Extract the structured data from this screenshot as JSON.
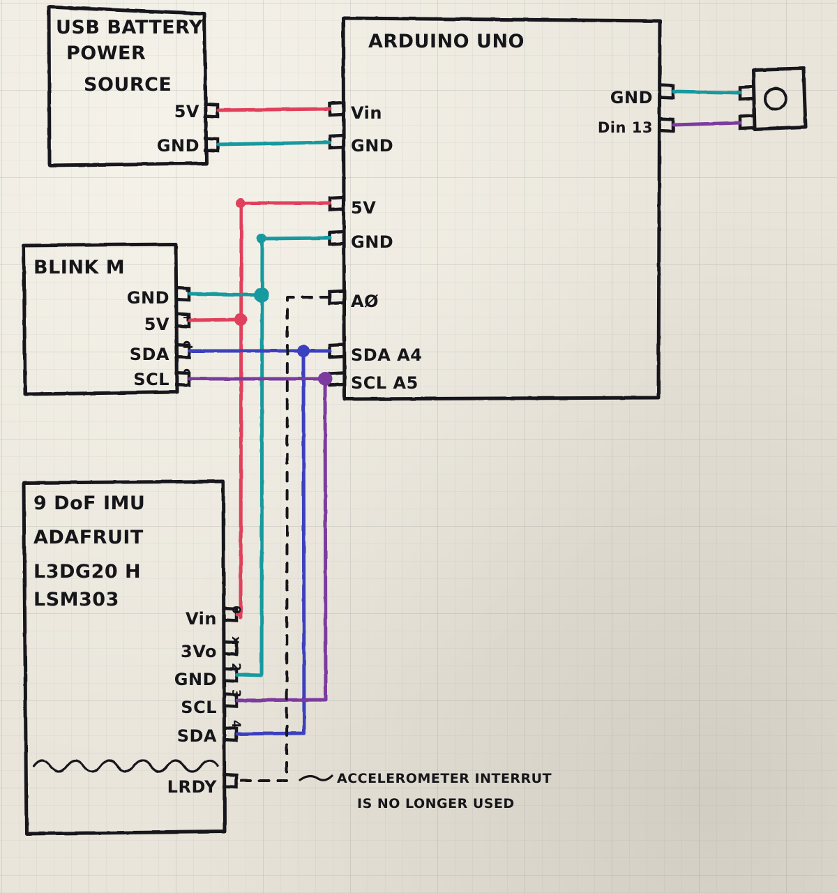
{
  "diagram": {
    "title": "Hand-drawn Arduino Uno wiring diagram on graph paper",
    "medium": "pen on graph paper"
  },
  "colors": {
    "ink": "#16161a",
    "paper": "#e9e5db",
    "wire_power_red": "#e0415c",
    "wire_ground_teal": "#17999f",
    "wire_sda_blue": "#3a3fbe",
    "wire_scl_purple": "#7b3b9e"
  },
  "blocks": {
    "usb_battery": {
      "title_lines": [
        "USB BATTERY",
        "POWER",
        "SOURCE"
      ],
      "pins": [
        {
          "label": "5V",
          "wire": "wire_power_red"
        },
        {
          "label": "GND",
          "wire": "wire_ground_teal"
        }
      ]
    },
    "arduino": {
      "title": "ARDUINO UNO",
      "left_pins": [
        {
          "label": "Vin",
          "wire": "wire_power_red"
        },
        {
          "label": "GND",
          "wire": "wire_ground_teal"
        },
        {
          "label": "5V",
          "wire": "wire_power_red"
        },
        {
          "label": "GND",
          "wire": "wire_ground_teal"
        },
        {
          "label": "AØ",
          "wire": "dashed"
        },
        {
          "label": "SDA A4",
          "wire": "wire_sda_blue"
        },
        {
          "label": "SCL A5",
          "wire": "wire_scl_purple"
        }
      ],
      "right_pins": [
        {
          "label": "GND",
          "wire": "wire_ground_teal"
        },
        {
          "label": "Din 13",
          "wire": "wire_scl_purple"
        }
      ]
    },
    "blinkm": {
      "title": "BLINK M",
      "pins": [
        {
          "label": "GND",
          "tab": "-",
          "wire": "wire_ground_teal"
        },
        {
          "label": "5V",
          "tab": "+",
          "wire": "wire_power_red"
        },
        {
          "label": "SDA",
          "tab": "d",
          "wire": "wire_sda_blue"
        },
        {
          "label": "SCL",
          "tab": "c",
          "wire": "wire_scl_purple"
        }
      ]
    },
    "imu": {
      "title_lines": [
        "9 DoF IMU",
        "ADAFRUIT",
        "L3DG20 H",
        "LSM303"
      ],
      "pins": [
        {
          "label": "Vin",
          "tab": "0",
          "wire": "wire_power_red"
        },
        {
          "label": "3Vo",
          "tab": "x",
          "wire": "none"
        },
        {
          "label": "GND",
          "tab": "2",
          "wire": "wire_ground_teal"
        },
        {
          "label": "SCL",
          "tab": "3",
          "wire": "wire_scl_purple"
        },
        {
          "label": "SDA",
          "tab": "4",
          "wire": "wire_sda_blue"
        },
        {
          "label": "LRDY",
          "tab": "",
          "wire": "dashed"
        }
      ]
    },
    "output_device": {
      "label": "",
      "shape": "box-with-circle",
      "pins": [
        {
          "label": "",
          "wire": "wire_ground_teal"
        },
        {
          "label": "",
          "wire": "wire_scl_purple"
        }
      ]
    }
  },
  "annotations": {
    "accelerometer_note": [
      "ACCELEROMETER INTERRUT",
      "IS NO LONGER USED"
    ]
  },
  "connections": [
    {
      "from": "usb_battery.5V",
      "to": "arduino.Vin",
      "color": "wire_power_red"
    },
    {
      "from": "usb_battery.GND",
      "to": "arduino.GND",
      "color": "wire_ground_teal"
    },
    {
      "from": "arduino.5V",
      "to": "blinkm.5V",
      "color": "wire_power_red"
    },
    {
      "from": "arduino.5V",
      "to": "imu.Vin",
      "color": "wire_power_red"
    },
    {
      "from": "arduino.GND",
      "to": "blinkm.GND",
      "color": "wire_ground_teal"
    },
    {
      "from": "arduino.GND",
      "to": "imu.GND",
      "color": "wire_ground_teal"
    },
    {
      "from": "arduino.SDA A4",
      "to": "blinkm.SDA",
      "color": "wire_sda_blue"
    },
    {
      "from": "arduino.SDA A4",
      "to": "imu.SDA",
      "color": "wire_sda_blue"
    },
    {
      "from": "arduino.SCL A5",
      "to": "blinkm.SCL",
      "color": "wire_scl_purple"
    },
    {
      "from": "arduino.SCL A5",
      "to": "imu.SCL",
      "color": "wire_scl_purple"
    },
    {
      "from": "arduino.AØ",
      "to": "imu.LRDY",
      "color": "dashed"
    },
    {
      "from": "arduino.GND-right",
      "to": "output_device.pin1",
      "color": "wire_ground_teal"
    },
    {
      "from": "arduino.Din 13",
      "to": "output_device.pin2",
      "color": "wire_scl_purple"
    }
  ]
}
